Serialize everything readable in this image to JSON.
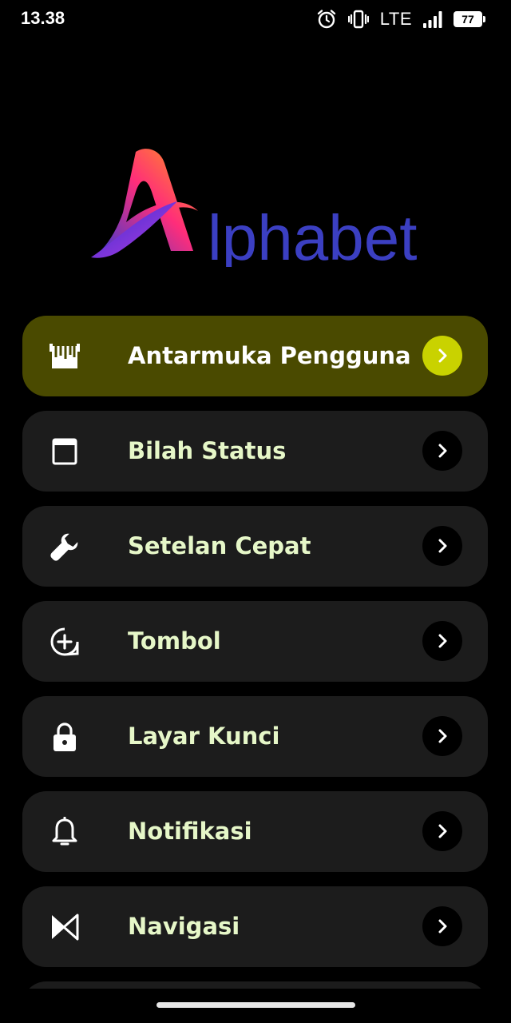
{
  "status_bar": {
    "time": "13.38",
    "network": "LTE",
    "battery": "77",
    "icons": [
      "alarm-icon",
      "vibrate-icon",
      "signal-icon",
      "battery-icon"
    ]
  },
  "logo": {
    "text": "lphabet",
    "full_name": "Alphabet",
    "colors": {
      "text": "#3b3fc2",
      "gradient_start": "#ff9a1a",
      "gradient_mid": "#ff2d7a",
      "gradient_end": "#2a3bd8"
    }
  },
  "menu": {
    "items": [
      {
        "label": "Antarmuka Pengguna",
        "icon": "ui-tuner-icon",
        "active": true
      },
      {
        "label": "Bilah Status",
        "icon": "status-bar-icon",
        "active": false
      },
      {
        "label": "Setelan Cepat",
        "icon": "wrench-icon",
        "active": false
      },
      {
        "label": "Tombol",
        "icon": "add-button-icon",
        "active": false
      },
      {
        "label": "Layar Kunci",
        "icon": "lock-icon",
        "active": false
      },
      {
        "label": "Notifikasi",
        "icon": "bell-icon",
        "active": false
      },
      {
        "label": "Navigasi",
        "icon": "navigation-icon",
        "active": false
      }
    ]
  },
  "colors": {
    "background": "#000000",
    "card": "#1c1c1c",
    "active_card": "#4a4a00",
    "active_chevron": "#c9d200",
    "label": "#e6f7c8"
  }
}
